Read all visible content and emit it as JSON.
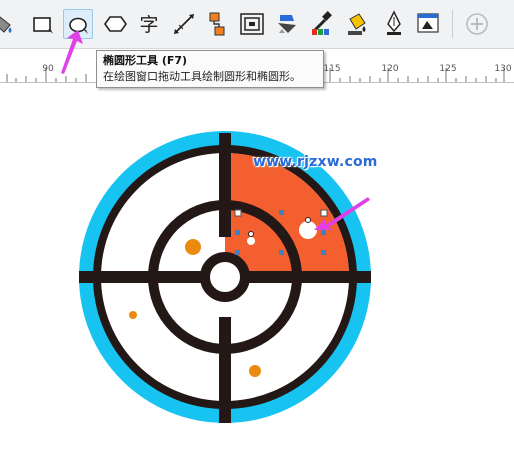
{
  "toolbar": {
    "tools": [
      {
        "name": "smart-fill",
        "icon": "paint-bucket-icon"
      },
      {
        "name": "rectangle-tool",
        "icon": "rectangle-icon"
      },
      {
        "name": "ellipse-tool",
        "icon": "ellipse-icon",
        "active": true
      },
      {
        "name": "polygon-tool",
        "icon": "hexagon-icon"
      },
      {
        "name": "text-tool",
        "icon": "text-glyph-icon",
        "glyph": "字"
      },
      {
        "name": "dimension-tool",
        "icon": "dimension-icon"
      },
      {
        "name": "connector-tool",
        "icon": "connector-icon"
      },
      {
        "name": "contour-tool",
        "icon": "contour-icon"
      },
      {
        "name": "transparency-tool",
        "icon": "transparency-icon"
      },
      {
        "name": "eyedropper-tool",
        "icon": "eyedropper-icon"
      },
      {
        "name": "interactive-fill-tool",
        "icon": "fill-bucket-icon"
      },
      {
        "name": "outline-pen-tool",
        "icon": "pen-nib-icon"
      },
      {
        "name": "color-dialog-tool",
        "icon": "color-window-icon"
      },
      {
        "name": "add-tool",
        "icon": "plus-icon"
      }
    ]
  },
  "tooltip": {
    "title": "椭圆形工具 (F7)",
    "description": "在绘图窗口拖动工具绘制圆形和椭圆形。"
  },
  "ruler": {
    "labels": [
      "90",
      "115",
      "120",
      "125",
      "130"
    ]
  },
  "watermark": "www.rjzxw.com",
  "colors": {
    "outer_ring": "#17c3f0",
    "line": "#231815",
    "quadrant": "#f35f2e",
    "dot": "#ea8a10",
    "selection_handle": "#3b82c4",
    "pointer_arrow": "#e040e8"
  }
}
